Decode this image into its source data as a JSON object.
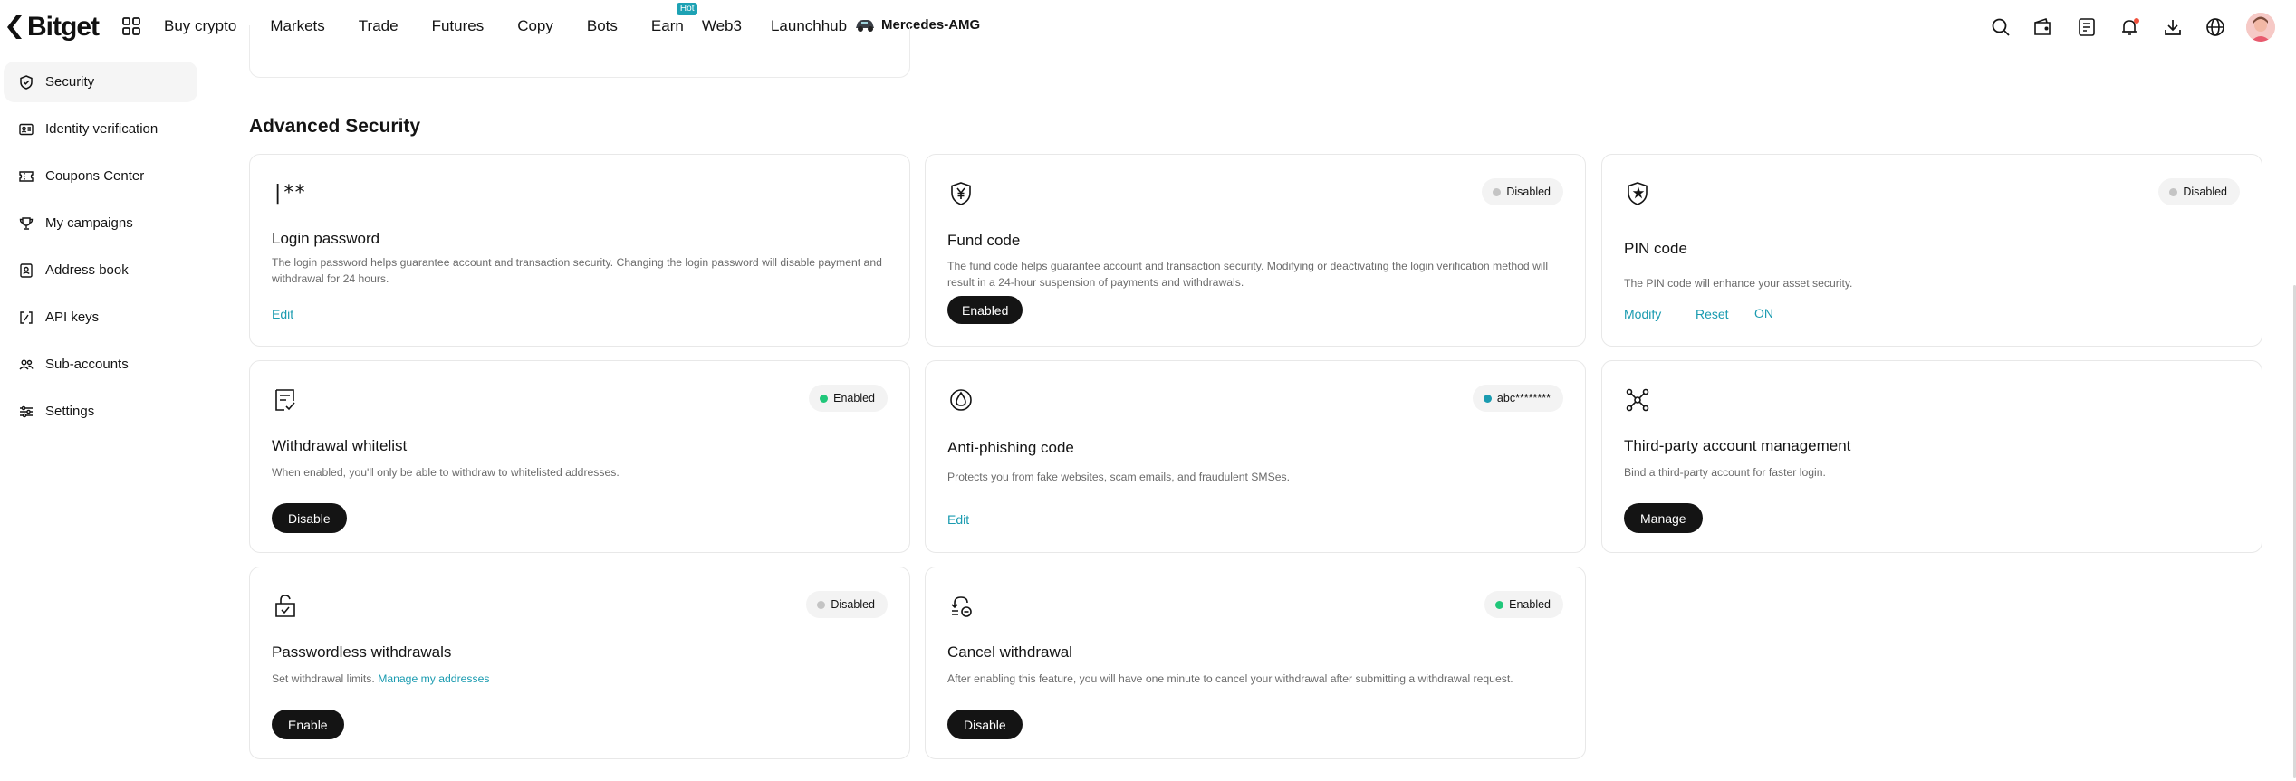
{
  "brand": {
    "name": "Bitget",
    "accent": "#1a9bb0"
  },
  "nav": {
    "items": [
      "Buy crypto",
      "Markets",
      "Trade",
      "Futures",
      "Copy",
      "Bots",
      "Earn",
      "Web3",
      "Launchhub"
    ],
    "hot_badge": "Hot",
    "partner": "Mercedes-AMG"
  },
  "top_icons": [
    "search-icon",
    "wallet-icon",
    "orders-icon",
    "bell-icon",
    "download-icon",
    "globe-icon"
  ],
  "sidebar": {
    "items": [
      {
        "label": "Security",
        "icon": "shield-icon",
        "active": true
      },
      {
        "label": "Identity verification",
        "icon": "id-card-icon"
      },
      {
        "label": "Coupons Center",
        "icon": "coupon-icon"
      },
      {
        "label": "My campaigns",
        "icon": "trophy-icon"
      },
      {
        "label": "Address book",
        "icon": "address-book-icon"
      },
      {
        "label": "API keys",
        "icon": "api-icon"
      },
      {
        "label": "Sub-accounts",
        "icon": "users-icon"
      },
      {
        "label": "Settings",
        "icon": "settings-icon"
      }
    ]
  },
  "main": {
    "section_title": "Advanced Security",
    "cards": {
      "login_password": {
        "icon_text": "|**",
        "title": "Login password",
        "desc": "The login password helps guarantee account and transaction security. Changing the login password will disable payment and withdrawal for 24 hours.",
        "action": "Edit"
      },
      "fund_code": {
        "title": "Fund code",
        "status": "Disabled",
        "desc": "The fund code helps guarantee account and transaction security. Modifying or deactivating the login verification method will result in a 24-hour suspension of payments and withdrawals.",
        "action": "Enabled"
      },
      "pin_code": {
        "title": "PIN code",
        "status": "Disabled",
        "desc": "The PIN code will enhance your asset security.",
        "actions": [
          "Modify",
          "Reset",
          "ON"
        ]
      },
      "withdrawal_whitelist": {
        "title": "Withdrawal whitelist",
        "status": "Enabled",
        "desc": "When enabled, you'll only be able to withdraw to whitelisted addresses.",
        "action": "Disable"
      },
      "anti_phishing": {
        "title": "Anti-phishing code",
        "status": "abc********",
        "desc": "Protects you from fake websites, scam emails, and fraudulent SMSes.",
        "action": "Edit"
      },
      "third_party": {
        "title": "Third-party account management",
        "desc": "Bind a third-party account for faster login.",
        "action": "Manage"
      },
      "passwordless": {
        "title": "Passwordless withdrawals",
        "status": "Disabled",
        "desc": "Set withdrawal limits.",
        "desc_link": "Manage my addresses",
        "action": "Enable"
      },
      "cancel_withdrawal": {
        "title": "Cancel withdrawal",
        "status": "Enabled",
        "desc": "After enabling this feature, you will have one minute to cancel your withdrawal after submitting a withdrawal request.",
        "action": "Disable"
      }
    }
  }
}
